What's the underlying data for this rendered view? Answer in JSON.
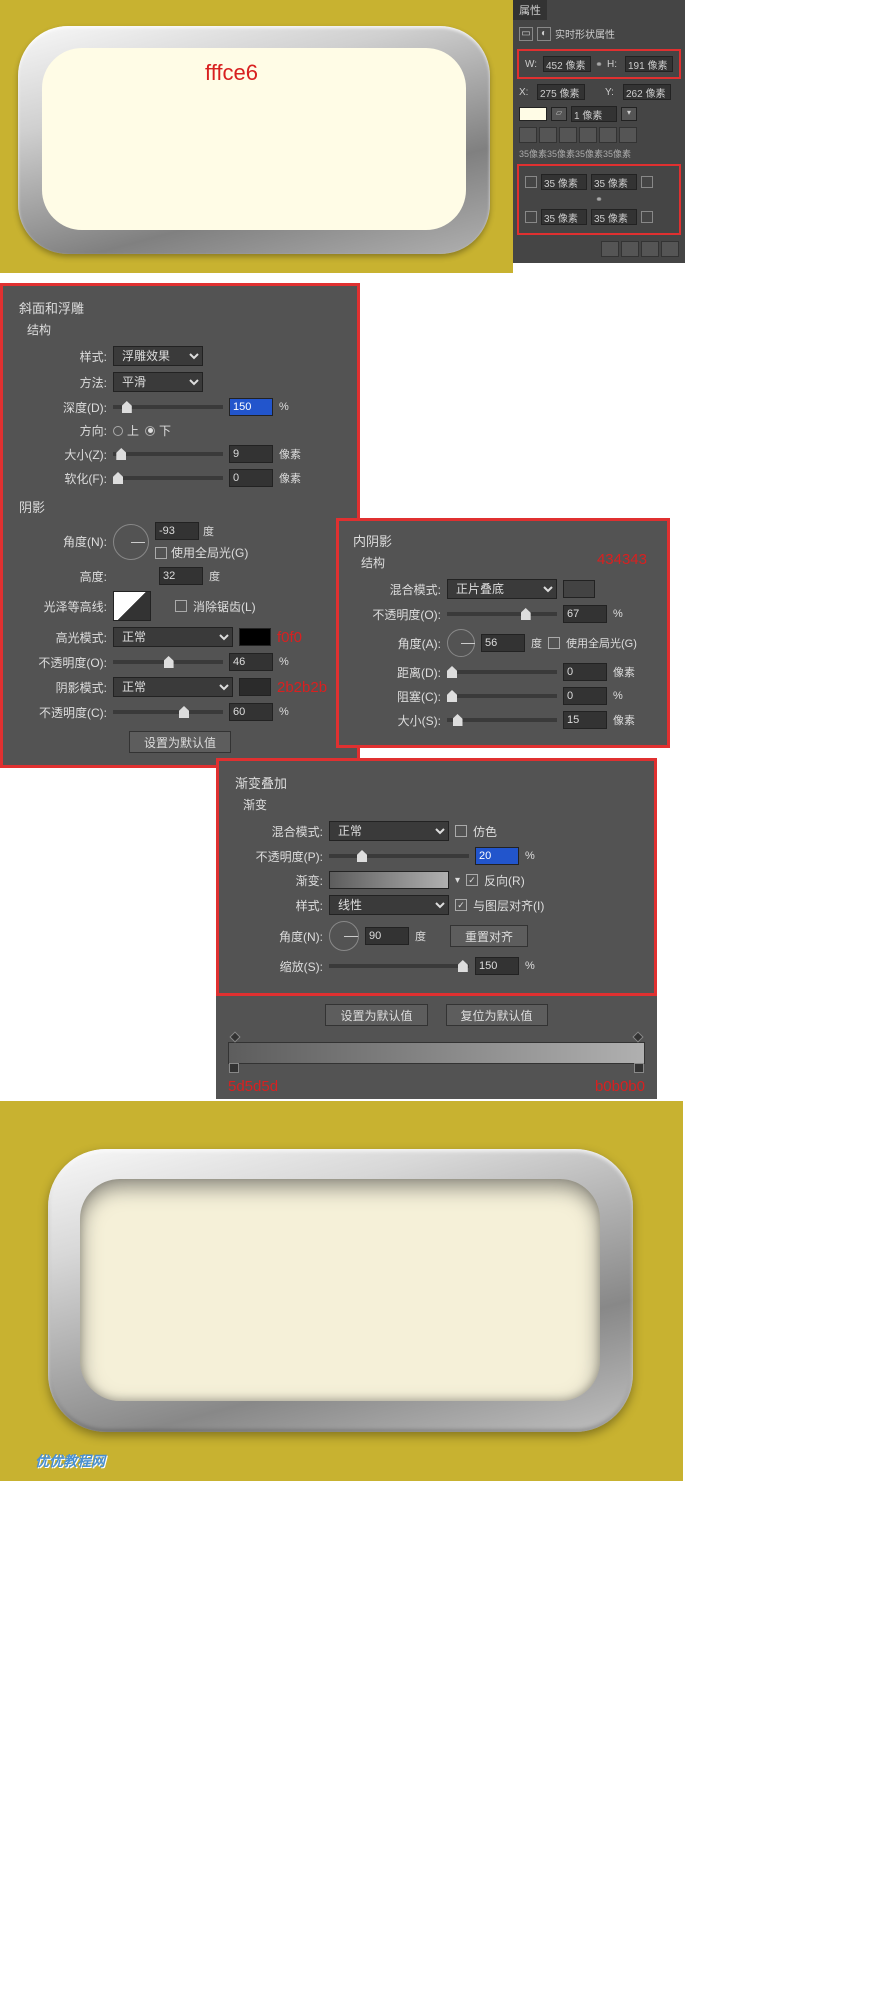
{
  "preview1": {
    "color_label": "fffce6"
  },
  "properties_panel": {
    "tab": "属性",
    "header": "实时形状属性",
    "W_label": "W:",
    "W_value": "452 像素",
    "link": "⚭",
    "H_label": "H:",
    "H_value": "191 像素",
    "X_label": "X:",
    "X_value": "275 像素",
    "Y_label": "Y:",
    "Y_value": "262 像素",
    "stroke_value": "1 像素",
    "radius_line": "35像素35像素35像素35像素",
    "corners": {
      "tl": "35 像素",
      "tr": "35 像素",
      "bl": "35 像素",
      "br": "35 像素",
      "link": "⚭"
    }
  },
  "bevel": {
    "title": "斜面和浮雕",
    "struct": "结构",
    "style_lbl": "样式:",
    "style_val": "浮雕效果",
    "method_lbl": "方法:",
    "method_val": "平滑",
    "depth_lbl": "深度(D):",
    "depth_val": "150",
    "pct": "%",
    "dir_lbl": "方向:",
    "dir_up": "上",
    "dir_down": "下",
    "size_lbl": "大小(Z):",
    "size_val": "9",
    "px": "像素",
    "soften_lbl": "软化(F):",
    "soften_val": "0",
    "shade": "阴影",
    "angle_lbl": "角度(N):",
    "angle_val": "-93",
    "deg": "度",
    "global_lbl": "使用全局光(G)",
    "alt_lbl": "高度:",
    "alt_val": "32",
    "gloss_lbl": "光泽等高线:",
    "aa_lbl": "消除锯齿(L)",
    "hi_mode_lbl": "高光模式:",
    "hi_mode_val": "正常",
    "hi_color": "f0f0",
    "hi_opac_lbl": "不透明度(O):",
    "hi_opac_val": "46",
    "sh_mode_lbl": "阴影模式:",
    "sh_mode_val": "正常",
    "sh_color": "2b2b2b",
    "sh_opac_lbl": "不透明度(C):",
    "sh_opac_val": "60",
    "default_btn": "设置为默认值"
  },
  "inner_shadow": {
    "title": "内阴影",
    "struct": "结构",
    "annot_color": "434343",
    "blend_lbl": "混合模式:",
    "blend_val": "正片叠底",
    "opac_lbl": "不透明度(O):",
    "opac_val": "67",
    "pct": "%",
    "angle_lbl": "角度(A):",
    "angle_val": "56",
    "deg": "度",
    "global_lbl": "使用全局光(G)",
    "dist_lbl": "距离(D):",
    "dist_val": "0",
    "px": "像素",
    "choke_lbl": "阻塞(C):",
    "choke_val": "0",
    "size_lbl": "大小(S):",
    "size_val": "15"
  },
  "gradient_overlay": {
    "title": "渐变叠加",
    "sub": "渐变",
    "blend_lbl": "混合模式:",
    "blend_val": "正常",
    "dither_lbl": "仿色",
    "opac_lbl": "不透明度(P):",
    "opac_val": "20",
    "pct": "%",
    "grad_lbl": "渐变:",
    "reverse_lbl": "反向(R)",
    "style_lbl": "样式:",
    "style_val": "线性",
    "align_lbl": "与图层对齐(I)",
    "angle_lbl": "角度(N):",
    "angle_val": "90",
    "deg": "度",
    "reset_btn": "重置对齐",
    "scale_lbl": "缩放(S):",
    "scale_val": "150",
    "default_btn": "设置为默认值",
    "reset_default_btn": "复位为默认值",
    "stop_left": "5d5d5d",
    "stop_right": "b0b0b0"
  },
  "watermark": "优优教程网"
}
